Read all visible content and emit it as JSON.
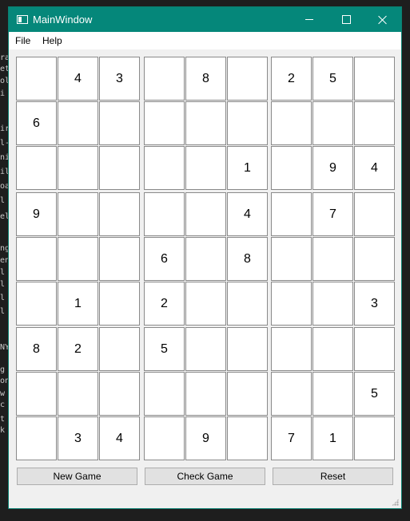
{
  "window": {
    "title": "MainWindow",
    "titlebar_color": "#05877a"
  },
  "menu": {
    "items": [
      {
        "label": "File"
      },
      {
        "label": "Help"
      }
    ]
  },
  "board": {
    "rows": [
      [
        "",
        "4",
        "3",
        "",
        "8",
        "",
        "2",
        "5",
        ""
      ],
      [
        "6",
        "",
        "",
        "",
        "",
        "",
        "",
        "",
        ""
      ],
      [
        "",
        "",
        "",
        "",
        "",
        "1",
        "",
        "9",
        "4"
      ],
      [
        "9",
        "",
        "",
        "",
        "",
        "4",
        "",
        "7",
        ""
      ],
      [
        "",
        "",
        "",
        "6",
        "",
        "8",
        "",
        "",
        ""
      ],
      [
        "",
        "1",
        "",
        "2",
        "",
        "",
        "",
        "",
        "3"
      ],
      [
        "8",
        "2",
        "",
        "5",
        "",
        "",
        "",
        "",
        ""
      ],
      [
        "",
        "",
        "",
        "",
        "",
        "",
        "",
        "",
        "5"
      ],
      [
        "",
        "3",
        "4",
        "",
        "9",
        "",
        "7",
        "1",
        ""
      ]
    ]
  },
  "buttons": {
    "new_game": "New Game",
    "check_game": "Check Game",
    "reset": "Reset"
  },
  "background_code": {
    "line_fragments": [
      "ra",
      "et",
      "ol",
      " i",
      "",
      "ir",
      "l-",
      "ni",
      "il",
      "oa",
      " l",
      "el",
      "",
      "ng",
      "en",
      "l",
      "l",
      "l",
      "l",
      "",
      "NY",
      "",
      "g",
      "on",
      " w",
      " c",
      "t",
      "k"
    ]
  }
}
